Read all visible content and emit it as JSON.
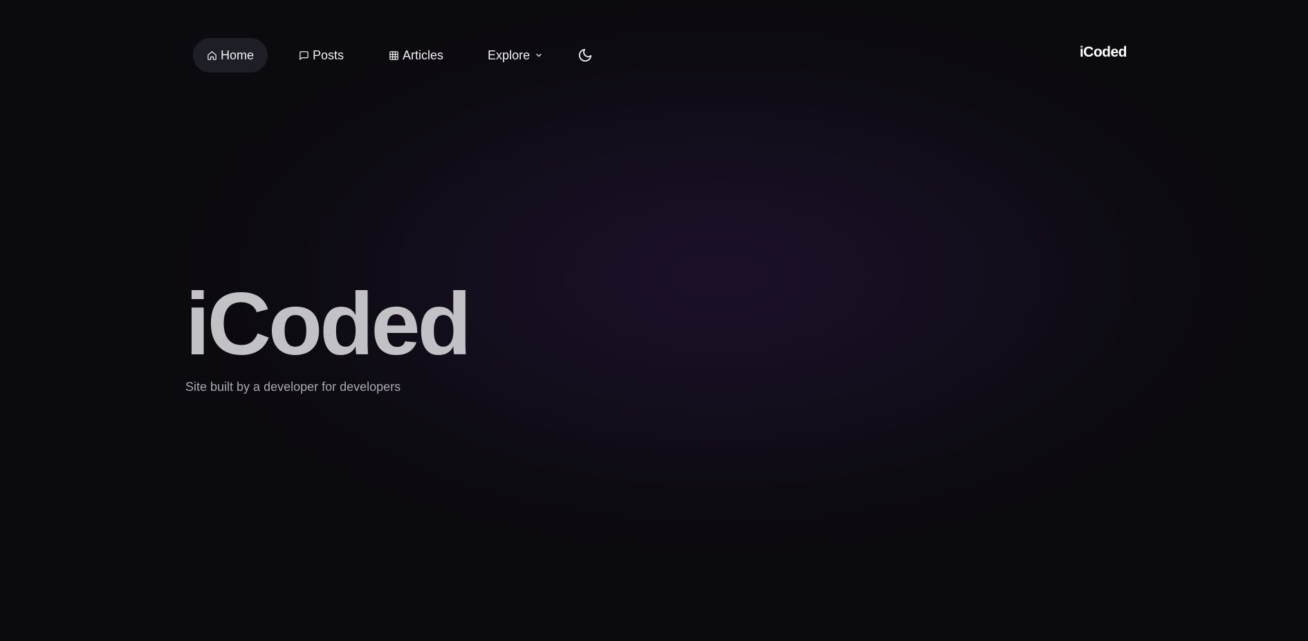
{
  "nav": {
    "items": [
      {
        "label": "Home",
        "icon": "home-icon",
        "active": true
      },
      {
        "label": "Posts",
        "icon": "message-square-icon",
        "active": false
      },
      {
        "label": "Articles",
        "icon": "grid-icon",
        "active": false
      },
      {
        "label": "Explore",
        "icon": "chevron-down-icon",
        "active": false
      }
    ],
    "theme_toggle_icon": "moon-icon"
  },
  "brand": {
    "name": "iCoded"
  },
  "hero": {
    "title": "iCoded",
    "subtitle": "Site built by a developer for developers"
  },
  "colors": {
    "background": "#0c0b10",
    "glow": "#1c1028",
    "active_pill": "#1e1e26",
    "hero_title": "#c2c1c6",
    "hero_subtitle": "#a9a8b0"
  }
}
